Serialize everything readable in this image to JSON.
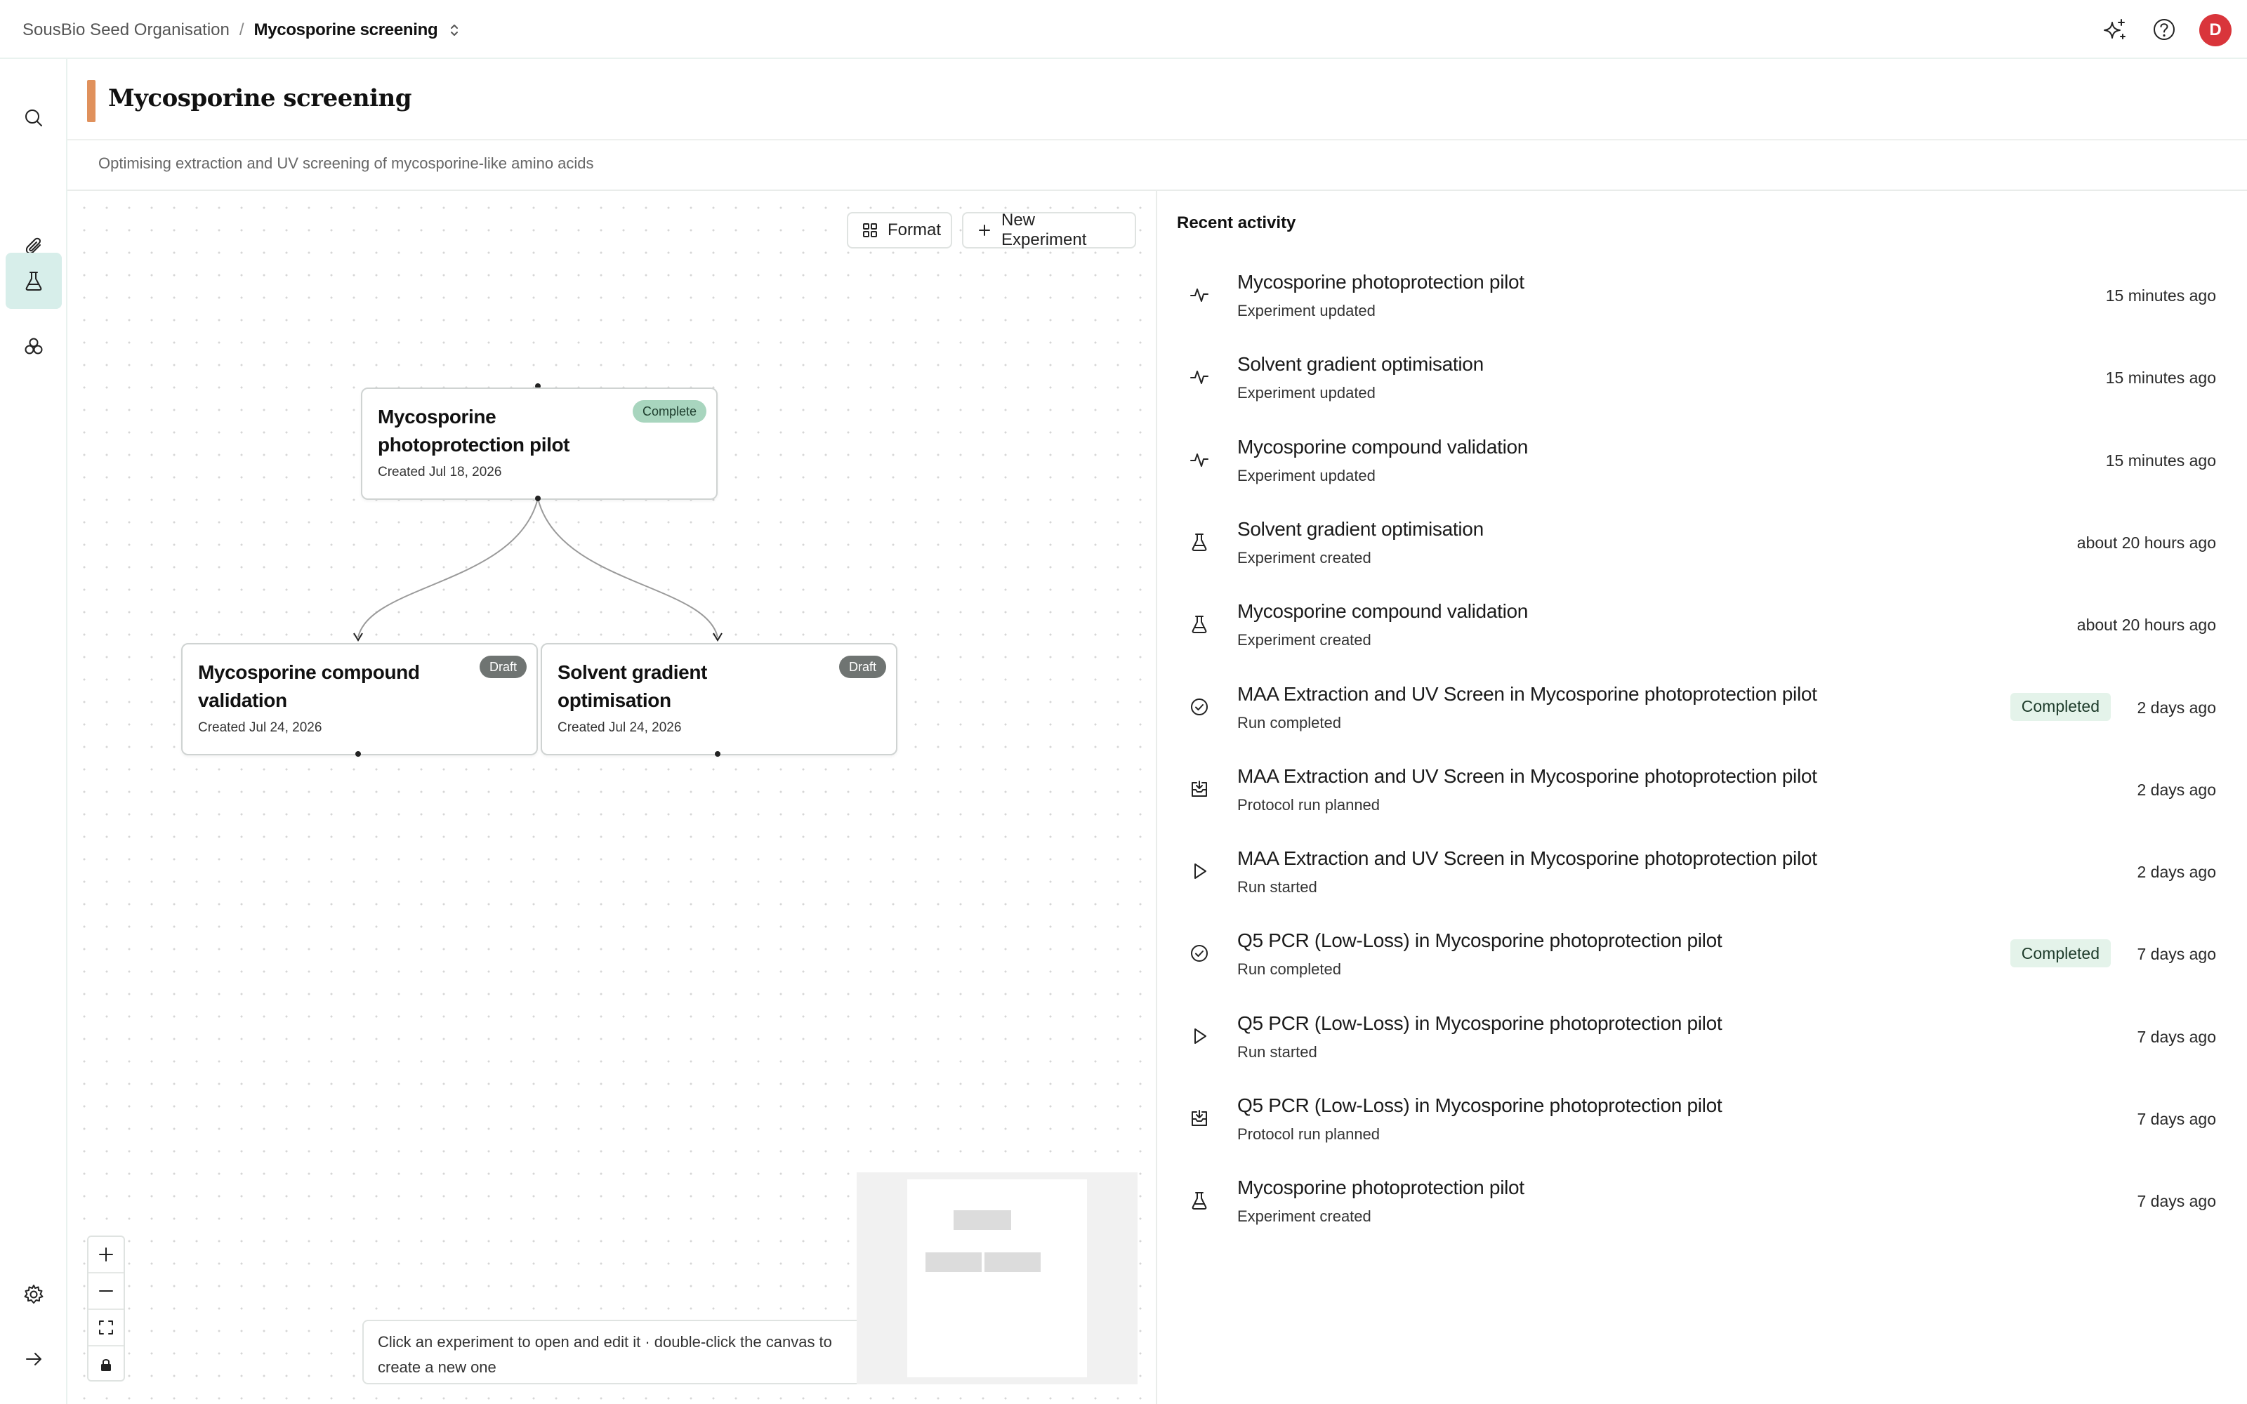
{
  "breadcrumb": {
    "org": "SousBio Seed Organisation",
    "separator": "/",
    "current": "Mycosporine screening"
  },
  "header_icons": [
    "sparkles-icon",
    "help-icon"
  ],
  "user": {
    "initial": "D"
  },
  "colors": {
    "accent_bar": "#e0915c",
    "rail_active": "#d7eeea",
    "avatar": "#d9353b",
    "badge_complete": "#a8d5be",
    "badge_draft": "#6f7472",
    "badge_completed_bg": "#e4f3ea"
  },
  "page": {
    "title": "Mycosporine screening",
    "description": "Optimising extraction and UV screening of mycosporine-like amino acids"
  },
  "canvas": {
    "format_label": "Format",
    "new_experiment_label": "New Experiment",
    "hint": "Click an experiment to open and edit it · double-click the canvas to create a new one",
    "nodes": [
      {
        "title": "Mycosporine photoprotection pilot",
        "created": "Created Jul 18, 2026",
        "status": "Complete"
      },
      {
        "title": "Mycosporine compound validation",
        "created": "Created Jul 24, 2026",
        "status": "Draft"
      },
      {
        "title": "Solvent gradient optimisation",
        "created": "Created Jul 24, 2026",
        "status": "Draft"
      }
    ]
  },
  "activity": {
    "heading": "Recent activity",
    "items": [
      {
        "icon": "activity-pulse-icon",
        "title": "Mycosporine photoprotection pilot",
        "subtitle": "Experiment updated",
        "badge": "",
        "time": "15 minutes ago"
      },
      {
        "icon": "activity-pulse-icon",
        "title": "Solvent gradient optimisation",
        "subtitle": "Experiment updated",
        "badge": "",
        "time": "15 minutes ago"
      },
      {
        "icon": "activity-pulse-icon",
        "title": "Mycosporine compound validation",
        "subtitle": "Experiment updated",
        "badge": "",
        "time": "15 minutes ago"
      },
      {
        "icon": "flask-icon",
        "title": "Solvent gradient optimisation",
        "subtitle": "Experiment created",
        "badge": "",
        "time": "about 20 hours ago"
      },
      {
        "icon": "flask-icon",
        "title": "Mycosporine compound validation",
        "subtitle": "Experiment created",
        "badge": "",
        "time": "about 20 hours ago"
      },
      {
        "icon": "check-circle-icon",
        "title": "MAA Extraction and UV Screen in Mycosporine photoprotection pilot",
        "subtitle": "Run completed",
        "badge": "Completed",
        "time": "2 days ago"
      },
      {
        "icon": "tray-download-icon",
        "title": "MAA Extraction and UV Screen in Mycosporine photoprotection pilot",
        "subtitle": "Protocol run planned",
        "badge": "",
        "time": "2 days ago"
      },
      {
        "icon": "play-icon",
        "title": "MAA Extraction and UV Screen in Mycosporine photoprotection pilot",
        "subtitle": "Run started",
        "badge": "",
        "time": "2 days ago"
      },
      {
        "icon": "check-circle-icon",
        "title": "Q5 PCR (Low-Loss) in Mycosporine photoprotection pilot",
        "subtitle": "Run completed",
        "badge": "Completed",
        "time": "7 days ago"
      },
      {
        "icon": "play-icon",
        "title": "Q5 PCR (Low-Loss) in Mycosporine photoprotection pilot",
        "subtitle": "Run started",
        "badge": "",
        "time": "7 days ago"
      },
      {
        "icon": "tray-download-icon",
        "title": "Q5 PCR (Low-Loss) in Mycosporine photoprotection pilot",
        "subtitle": "Protocol run planned",
        "badge": "",
        "time": "7 days ago"
      },
      {
        "icon": "flask-icon",
        "title": "Mycosporine photoprotection pilot",
        "subtitle": "Experiment created",
        "badge": "",
        "time": "7 days ago"
      }
    ]
  }
}
